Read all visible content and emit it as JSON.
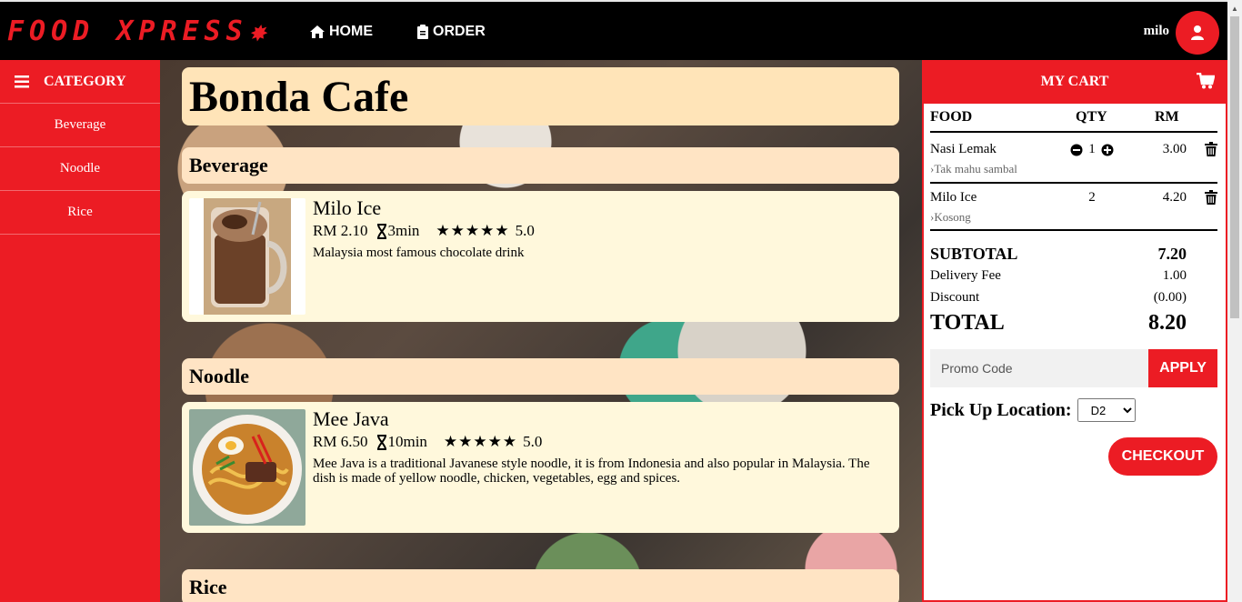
{
  "brand": {
    "name": "FOOD XPRESS",
    "accent_color": "#ec1c24"
  },
  "nav": {
    "home_label": "HOME",
    "order_label": "ORDER",
    "user_name": "milo"
  },
  "sidebar": {
    "header": "CATEGORY",
    "items": [
      {
        "label": "Beverage"
      },
      {
        "label": "Noodle"
      },
      {
        "label": "Rice"
      }
    ]
  },
  "restaurant": {
    "name": "Bonda Cafe",
    "categories": [
      {
        "name": "Beverage",
        "items": [
          {
            "name": "Milo Ice",
            "price": "RM 2.10",
            "time": "3min",
            "stars": "★★★★★",
            "rating": "5.0",
            "description": "Malaysia most famous chocolate drink",
            "image": "iced-chocolate-drink"
          }
        ]
      },
      {
        "name": "Noodle",
        "items": [
          {
            "name": "Mee Java",
            "price": "RM 6.50",
            "time": "10min",
            "stars": "★★★★★",
            "rating": "5.0",
            "description": "Mee Java is a traditional Javanese style noodle, it is from Indonesia and also popular in Malaysia. The dish is made of yellow noodle, chicken, vegetables, egg and spices.",
            "image": "noodle-soup-bowl"
          }
        ]
      },
      {
        "name": "Rice",
        "items": []
      }
    ]
  },
  "cart": {
    "title": "MY CART",
    "columns": {
      "food": "FOOD",
      "qty": "QTY",
      "rm": "RM"
    },
    "items": [
      {
        "name": "Nasi Lemak",
        "note": "Tak mahu sambal",
        "qty": "1",
        "price": "3.00",
        "editable": true
      },
      {
        "name": "Milo Ice",
        "note": "Kosong",
        "qty": "2",
        "price": "4.20",
        "editable": false
      }
    ],
    "subtotal_label": "SUBTOTAL",
    "subtotal": "7.20",
    "delivery_label": "Delivery Fee",
    "delivery": "1.00",
    "discount_label": "Discount",
    "discount": "(0.00)",
    "total_label": "TOTAL",
    "total": "8.20",
    "promo_placeholder": "Promo Code",
    "apply_label": "APPLY",
    "pickup_label": "Pick Up Location:",
    "pickup_value": "D2",
    "checkout_label": "CHECKOUT"
  }
}
